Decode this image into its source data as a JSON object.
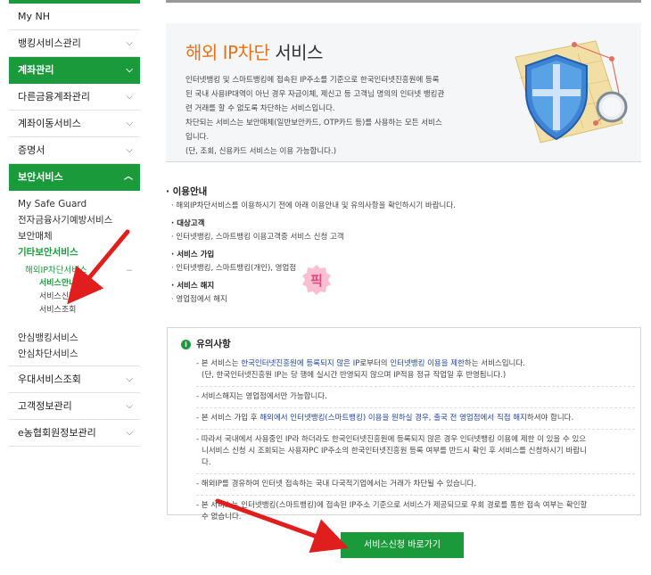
{
  "sidebar": {
    "top_items": [
      {
        "label": "My NH"
      },
      {
        "label": "뱅킹서비스관리",
        "chevron": "⌵"
      },
      {
        "label": "계좌관리",
        "chevron": "⌵"
      },
      {
        "label": "다른금융계좌관리",
        "chevron": "⌵"
      },
      {
        "label": "계좌이동서비스",
        "chevron": "⌵"
      },
      {
        "label": "증명서",
        "chevron": "⌵"
      },
      {
        "label": "보안서비스",
        "chevron": "︿"
      }
    ],
    "security_subitems": [
      "My Safe Guard",
      "전자금융사기예방서비스",
      "보안매체",
      "기타보안서비스"
    ],
    "ip_block": {
      "label": "해외IP차단서비스",
      "dash": "−",
      "children": [
        "서비스안내",
        "서비스신청",
        "서비스조회"
      ]
    },
    "after_items": [
      "안심뱅킹서비스",
      "안심차단서비스"
    ],
    "bottom_items": [
      {
        "label": "우대서비스조회",
        "chevron": "⌵"
      },
      {
        "label": "고객정보관리",
        "chevron": "⌵"
      },
      {
        "label": "e농협회원정보관리",
        "chevron": "⌵"
      }
    ]
  },
  "banner": {
    "title_accent": "해외 IP차단",
    "title_rest": " 서비스",
    "desc_lines": [
      "인터넷뱅킹 및 스마트뱅킹에 접속된 IP주소를 기준으로 한국인터넷진흥원에 등록",
      "된 국내 사용IP대역이 아닌 경우 자금이체, 제신고 등 고객님 명의의 인터넷 뱅킹관",
      "련 거래를 할 수 없도록 차단하는 서비스입니다.",
      "차단되는 서비스는 보안매체(일반보안카드, OTP카드 등)를 사용하는 모든 서비스",
      "입니다.",
      "(단, 조회, 신용카드 서비스는 이용 가능합니다.)"
    ]
  },
  "usage": {
    "title": "· 이용안내",
    "intro": "· 해외IP차단서비스를 이용하시기 전에 아래 이용안내 및 유의사항을 확인하시기 바랍니다.",
    "sections": [
      {
        "heading": "· 대상고객",
        "text": "· 인터넷뱅킹, 스마트뱅킹 이용고객중 서비스 신청 고객"
      },
      {
        "heading": "· 서비스 가입",
        "text": "· 인터넷뱅킹, 스마트뱅킹(개인), 영업점"
      },
      {
        "heading": "· 서비스 해지",
        "text": "· 영업점에서 해지"
      }
    ]
  },
  "watermark": {
    "text": "픽",
    "color": "#f06a9a"
  },
  "notice": {
    "icon": "i",
    "title": "유의사항",
    "items": [
      {
        "parts": [
          {
            "t": "- 본 서비스는 "
          },
          {
            "t": "한국인터넷진흥원에 등록되지 않은 IP",
            "c": "blue"
          },
          {
            "t": "로부터의 "
          },
          {
            "t": "인터넷뱅킹 이용을 제한",
            "c": "blue"
          },
          {
            "t": "하는 서비스입니다."
          }
        ],
        "line2": "(단, 한국인터넷진흥원 IP는 당 행에 실시간 반영되지 않으며 IP적용 정규 작업일 후 반영됩니다.)"
      },
      {
        "parts": [
          {
            "t": "- 서비스해지는 영업점에서만 가능합니다."
          }
        ]
      },
      {
        "parts": [
          {
            "t": "- 본 서비스 가입 후 "
          },
          {
            "t": "해외에서 인터넷뱅킹(스마트뱅킹) 이용을 원하실 경우, 출국 전 영업점에서 직접 해지",
            "c": "blue"
          },
          {
            "t": "하셔야 합니다."
          }
        ]
      },
      {
        "parts": [
          {
            "t": "- 따라서 국내에서 사용중인 IP라 하더라도 한국인터넷진흥원에 등록되지 않은 경우 인터넷뱅킹 이용에 제한 이 있을 수 있으"
          }
        ],
        "line2": "니서비스 신청 시 조회되는 사용자PC IP주소의 한국인터넷진흥원 등록 여부를 반드시 확인 후 서비스를 신청하시기 바랍니",
        "line3": "다."
      },
      {
        "parts": [
          {
            "t": "- 해외IP를 경유하여 인터넷 접속하는 국내 다국적기업에서는 거래가 차단될 수 있습니다."
          }
        ]
      },
      {
        "parts": [
          {
            "t": "- 본 서비스는 인터넷뱅킹(스마트뱅킹)에 접속된 IP주소 기준으로 서비스가 제공되므로 우회 경로를 통한 접속 여부는 확인할"
          }
        ],
        "line2": "수 없습니다."
      }
    ]
  },
  "cta": {
    "label": "서비스신청 바로가기"
  },
  "colors": {
    "brand_green": "#1a9a3a",
    "accent_orange": "#e0731d",
    "link_blue": "#2245a0",
    "arrow_red": "#e01e1e"
  }
}
